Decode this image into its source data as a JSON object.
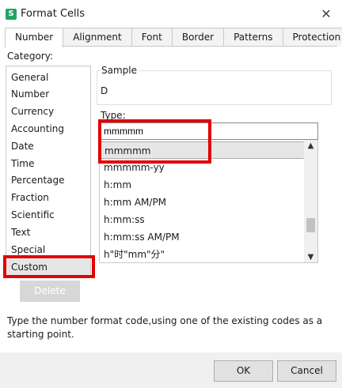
{
  "window": {
    "title": "Format Cells",
    "app_icon_glyph": "S",
    "close_glyph": "✕"
  },
  "tabs": [
    "Number",
    "Alignment",
    "Font",
    "Border",
    "Patterns",
    "Protection"
  ],
  "category": {
    "label": "Category:",
    "items": [
      "General",
      "Number",
      "Currency",
      "Accounting",
      "Date",
      "Time",
      "Percentage",
      "Fraction",
      "Scientific",
      "Text",
      "Special",
      "Custom"
    ],
    "selected": "Custom"
  },
  "sample": {
    "label": "Sample",
    "value": "D"
  },
  "type": {
    "label": "Type:",
    "input_value": "mmmmm",
    "options": [
      "mmmmm",
      "mmmmm-yy",
      "h:mm",
      "h:mm AM/PM",
      "h:mm:ss",
      "h:mm:ss AM/PM",
      "h\"时\"mm\"分\""
    ],
    "selected": "mmmmm"
  },
  "delete_label": "Delete",
  "hint": "Type the number format code,using one of the existing codes as a starting point.",
  "buttons": {
    "ok": "OK",
    "cancel": "Cancel"
  },
  "colors": {
    "highlight": "#e30000",
    "app_icon": "#21a366",
    "selection": "#e6e6e6"
  },
  "icons": {
    "scroll_up": "▲",
    "scroll_down": "▼"
  }
}
